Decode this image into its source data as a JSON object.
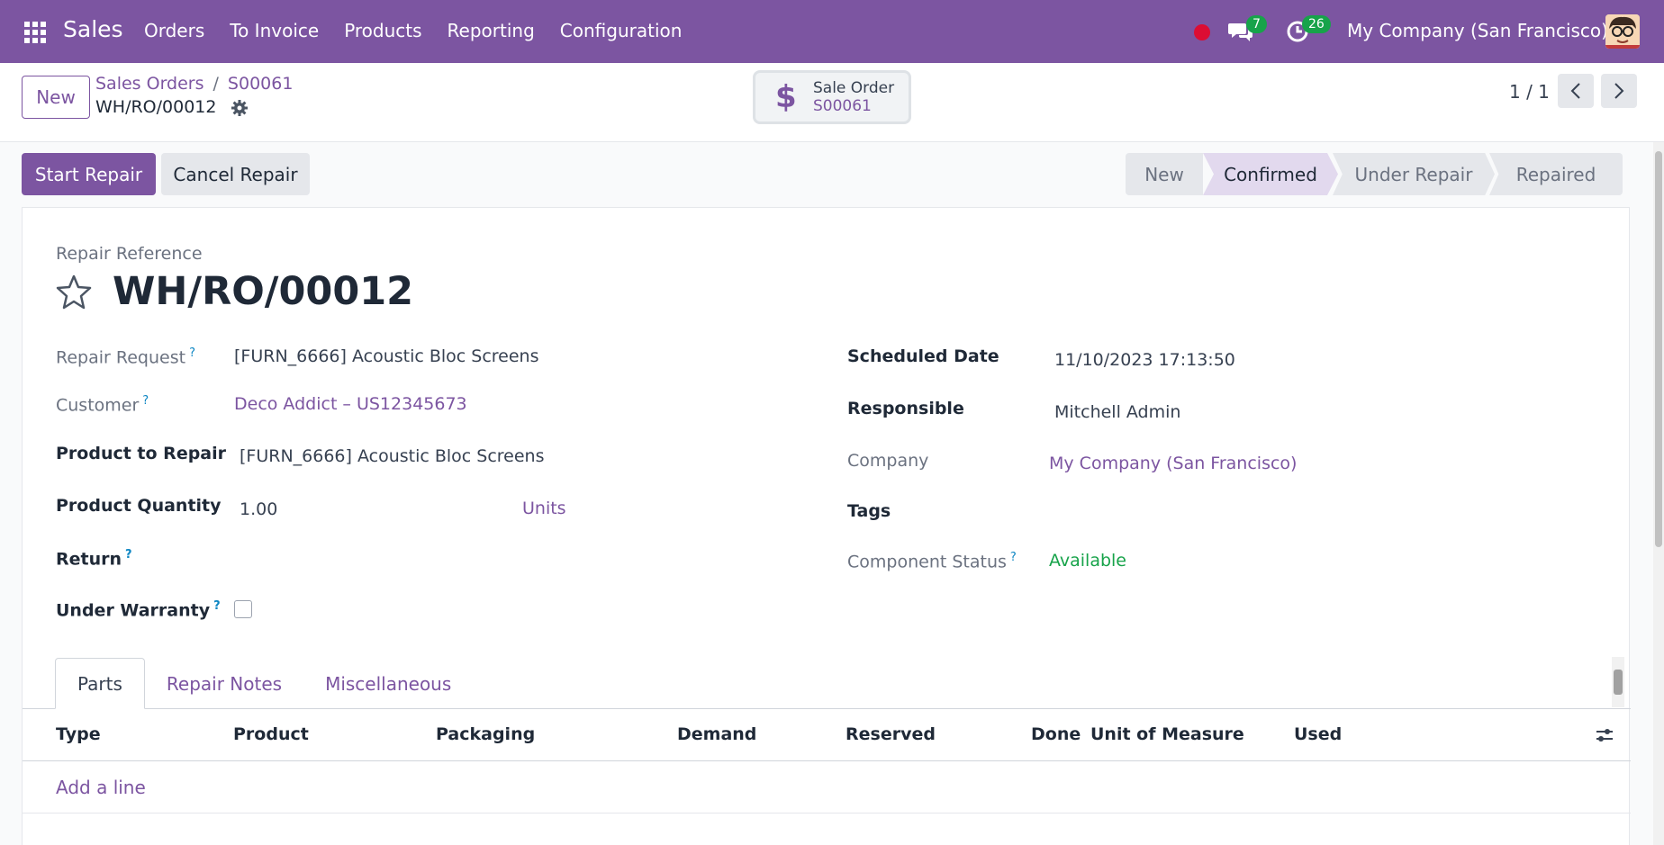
{
  "navbar": {
    "app_name": "Sales",
    "menu": [
      "Orders",
      "To Invoice",
      "Products",
      "Reporting",
      "Configuration"
    ],
    "messages_count": "7",
    "activities_count": "26",
    "company": "My Company (San Francisco)",
    "accent_color": "#7c55a1",
    "icons": [
      "apps-grid-icon",
      "record-dot-icon",
      "chat-icon",
      "clock-icon",
      "avatar"
    ]
  },
  "control": {
    "new_label": "New",
    "breadcrumb": [
      "Sales Orders",
      "S00061"
    ],
    "record_name": "WH/RO/00012",
    "smart_button": {
      "title": "Sale Order",
      "value": "S00061"
    },
    "pager": "1 / 1"
  },
  "actions": {
    "start_repair": "Start Repair",
    "cancel_repair": "Cancel Repair"
  },
  "status": {
    "stages": [
      "New",
      "Confirmed",
      "Under Repair",
      "Repaired"
    ],
    "current": "Confirmed"
  },
  "form": {
    "ref_label": "Repair Reference",
    "ref_value": "WH/RO/00012",
    "left": {
      "repair_request_label": "Repair Request",
      "repair_request_value": "[FURN_6666] Acoustic Bloc Screens",
      "customer_label": "Customer",
      "customer_value": "Deco Addict – US12345673",
      "product_label": "Product to Repair",
      "product_value": "[FURN_6666] Acoustic Bloc Screens",
      "quantity_label": "Product Quantity",
      "quantity_value": "1.00",
      "uom_value": "Units",
      "return_label": "Return",
      "warranty_label": "Under Warranty",
      "help_mark": "?"
    },
    "right": {
      "scheduled_label": "Scheduled Date",
      "scheduled_value": "11/10/2023 17:13:50",
      "responsible_label": "Responsible",
      "responsible_value": "Mitchell Admin",
      "company_label": "Company",
      "company_value": "My Company (San Francisco)",
      "tags_label": "Tags",
      "component_label": "Component Status",
      "component_value": "Available"
    }
  },
  "tabs": [
    "Parts",
    "Repair Notes",
    "Miscellaneous"
  ],
  "table": {
    "columns": [
      "Type",
      "Product",
      "Packaging",
      "Demand",
      "Reserved",
      "Done",
      "Unit of Measure",
      "Used"
    ],
    "add_line": "Add a line"
  }
}
